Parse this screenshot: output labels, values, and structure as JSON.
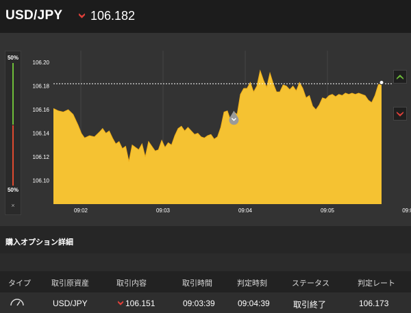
{
  "header": {
    "pair": "USD/JPY",
    "rate": "106.182",
    "rate_direction_icon": "down-arrow-icon",
    "down_color": "#e0403a"
  },
  "ratio": {
    "top_label": "50%",
    "bottom_label": "50%",
    "close_label": "×",
    "high_color": "#6fbf3a",
    "low_color": "#e04a2f"
  },
  "chart_data": {
    "type": "area",
    "x_ticks": [
      "09:02",
      "09:03",
      "09:04",
      "09:05",
      "09:0"
    ],
    "y_ticks": [
      "106.20",
      "106.18",
      "106.16",
      "106.14",
      "106.12",
      "106.10"
    ],
    "ylim": [
      106.08,
      106.21
    ],
    "reference_line": 106.182,
    "current_price": 106.182,
    "fill_color": "#f5c232",
    "points": [
      [
        0.0,
        106.161
      ],
      [
        1.5,
        106.159
      ],
      [
        3.0,
        106.158
      ],
      [
        4.5,
        106.16
      ],
      [
        6.0,
        106.156
      ],
      [
        7.5,
        106.147
      ],
      [
        8.5,
        106.14
      ],
      [
        9.5,
        106.136
      ],
      [
        11.0,
        106.138
      ],
      [
        12.5,
        106.137
      ],
      [
        14.0,
        106.141
      ],
      [
        15.0,
        106.144
      ],
      [
        16.0,
        106.14
      ],
      [
        17.0,
        106.142
      ],
      [
        18.0,
        106.136
      ],
      [
        19.0,
        106.131
      ],
      [
        20.0,
        106.133
      ],
      [
        21.0,
        106.127
      ],
      [
        22.0,
        106.129
      ],
      [
        23.0,
        106.116
      ],
      [
        24.0,
        106.13
      ],
      [
        25.0,
        106.128
      ],
      [
        26.0,
        106.126
      ],
      [
        27.0,
        106.131
      ],
      [
        28.0,
        106.12
      ],
      [
        29.0,
        106.133
      ],
      [
        30.0,
        106.129
      ],
      [
        31.0,
        106.125
      ],
      [
        32.0,
        106.126
      ],
      [
        33.0,
        106.134
      ],
      [
        34.0,
        106.128
      ],
      [
        35.0,
        106.132
      ],
      [
        36.0,
        106.13
      ],
      [
        37.0,
        106.138
      ],
      [
        38.0,
        106.144
      ],
      [
        39.0,
        106.146
      ],
      [
        40.0,
        106.142
      ],
      [
        41.0,
        106.145
      ],
      [
        42.0,
        106.142
      ],
      [
        43.0,
        106.139
      ],
      [
        44.0,
        106.14
      ],
      [
        45.0,
        106.137
      ],
      [
        46.0,
        106.136
      ],
      [
        47.0,
        106.138
      ],
      [
        48.0,
        106.139
      ],
      [
        49.0,
        106.135
      ],
      [
        50.0,
        106.137
      ],
      [
        51.0,
        106.145
      ],
      [
        52.0,
        106.158
      ],
      [
        53.0,
        106.159
      ],
      [
        54.0,
        106.151
      ],
      [
        55.0,
        106.158
      ],
      [
        56.0,
        106.156
      ],
      [
        57.0,
        106.173
      ],
      [
        58.0,
        106.178
      ],
      [
        59.0,
        106.178
      ],
      [
        60.0,
        106.183
      ],
      [
        61.0,
        106.175
      ],
      [
        62.0,
        106.18
      ],
      [
        63.0,
        106.193
      ],
      [
        64.0,
        106.185
      ],
      [
        65.0,
        106.179
      ],
      [
        66.0,
        106.191
      ],
      [
        67.0,
        106.182
      ],
      [
        68.0,
        106.175
      ],
      [
        69.0,
        106.175
      ],
      [
        70.0,
        106.181
      ],
      [
        71.0,
        106.18
      ],
      [
        72.0,
        106.177
      ],
      [
        73.0,
        106.18
      ],
      [
        74.0,
        106.176
      ],
      [
        75.0,
        106.183
      ],
      [
        76.0,
        106.178
      ],
      [
        77.0,
        106.17
      ],
      [
        78.0,
        106.172
      ],
      [
        79.0,
        106.163
      ],
      [
        80.0,
        106.16
      ],
      [
        81.0,
        106.164
      ],
      [
        82.0,
        106.17
      ],
      [
        83.0,
        106.169
      ],
      [
        84.0,
        106.172
      ],
      [
        85.0,
        106.173
      ],
      [
        86.0,
        106.171
      ],
      [
        87.0,
        106.173
      ],
      [
        88.0,
        106.172
      ],
      [
        89.0,
        106.174
      ],
      [
        90.0,
        106.173
      ],
      [
        91.0,
        106.174
      ],
      [
        92.0,
        106.173
      ],
      [
        93.0,
        106.174
      ],
      [
        94.0,
        106.173
      ],
      [
        95.0,
        106.172
      ],
      [
        96.0,
        106.168
      ],
      [
        97.0,
        106.166
      ],
      [
        98.0,
        106.172
      ],
      [
        99.0,
        106.181
      ],
      [
        100.0,
        106.183
      ]
    ],
    "entry_marker": {
      "x": 55.0,
      "value": 106.151,
      "icon": "down-arrow-icon"
    }
  },
  "buttons": {
    "high_icon": "chevron-up-icon",
    "low_icon": "chevron-down-icon",
    "high_color": "#6fbf3a",
    "low_color": "#e0403a"
  },
  "section": {
    "title": "購入オプション詳細"
  },
  "table": {
    "headers": [
      "タイプ",
      "取引原資産",
      "取引内容",
      "取引時間",
      "判定時刻",
      "ステータス",
      "判定レート"
    ],
    "row": {
      "type_icon": "gauge-icon",
      "asset": "USD/JPY",
      "direction_icon": "down-arrow-icon",
      "content": "106.151",
      "trade_time": "09:03:39",
      "judge_time": "09:04:39",
      "status": "取引終了",
      "judge_rate": "106.173"
    }
  }
}
